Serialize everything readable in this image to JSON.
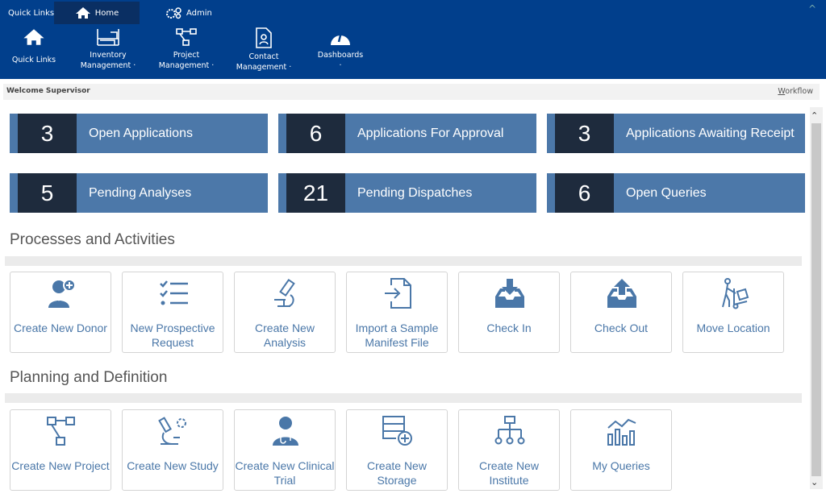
{
  "top_tabs": [
    {
      "label": "Quick Links"
    },
    {
      "label": "Home",
      "icon": "home-icon"
    },
    {
      "label": "Admin",
      "icon": "gears-icon"
    }
  ],
  "nav": [
    {
      "label": "Quick Links",
      "icon": "home-icon"
    },
    {
      "label": "Inventory\nManagement ·",
      "icon": "shelves-icon"
    },
    {
      "label": "Project\nManagement ·",
      "icon": "flow-icon"
    },
    {
      "label": "Contact\nManagement ·",
      "icon": "contact-icon"
    },
    {
      "label": "Dashboards\n·",
      "icon": "gauge-icon"
    }
  ],
  "welcome": "Welcome Supervisor",
  "workflow_first": "W",
  "workflow_rest": "orkflow",
  "stats": [
    {
      "value": "3",
      "label": "Open Applications"
    },
    {
      "value": "6",
      "label": "Applications For Approval"
    },
    {
      "value": "3",
      "label": "Applications Awaiting Receipt"
    },
    {
      "value": "5",
      "label": "Pending Analyses"
    },
    {
      "value": "21",
      "label": "Pending Dispatches"
    },
    {
      "value": "6",
      "label": "Open Queries"
    }
  ],
  "sections": {
    "processes": "Processes and Activities",
    "planning": "Planning and Definition"
  },
  "processes": [
    {
      "label": "Create New Donor",
      "icon": "add-user-icon"
    },
    {
      "label": "New Prospective Request",
      "icon": "checklist-icon"
    },
    {
      "label": "Create New Analysis",
      "icon": "microscope-icon"
    },
    {
      "label": "Import a Sample Manifest File",
      "icon": "import-file-icon"
    },
    {
      "label": "Check In",
      "icon": "inbox-in-icon"
    },
    {
      "label": "Check Out",
      "icon": "inbox-out-icon"
    },
    {
      "label": "Move Location",
      "icon": "trolley-icon"
    }
  ],
  "planning": [
    {
      "label": "Create New Project",
      "icon": "flow-icon"
    },
    {
      "label": "Create New Study",
      "icon": "study-icon"
    },
    {
      "label": "Create New Clinical Trial",
      "icon": "doctor-icon"
    },
    {
      "label": "Create New Storage",
      "icon": "storage-add-icon"
    },
    {
      "label": "Create New Institute",
      "icon": "hierarchy-icon"
    },
    {
      "label": "My Queries",
      "icon": "chart-icon"
    }
  ],
  "colors": {
    "header": "#013f8c",
    "tile": "#4c78a9",
    "tile_num": "#1e2b3d",
    "icon": "#4a77a8"
  }
}
